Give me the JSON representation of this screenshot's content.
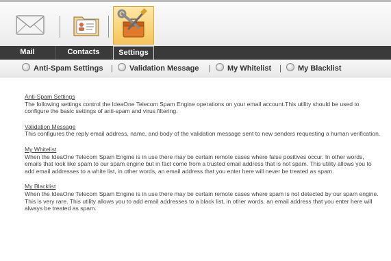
{
  "toolbar": {
    "icons": [
      {
        "name": "mail-envelope-icon"
      },
      {
        "name": "contacts-card-icon"
      },
      {
        "name": "settings-tools-icon",
        "active": true
      }
    ]
  },
  "tabs": [
    {
      "label": "Mail",
      "active": false
    },
    {
      "label": "Contacts",
      "active": false
    },
    {
      "label": "Settings",
      "active": true
    }
  ],
  "subnav": [
    {
      "label": "Anti-Spam Settings"
    },
    {
      "label": "Validation Message"
    },
    {
      "label": "My Whitelist"
    },
    {
      "label": "My Blacklist"
    }
  ],
  "sections": [
    {
      "title": "Anti-Spam Settings",
      "text": "The following settings control the IdeaOne Telecom Spam Engine operations on your email account.This utility should be used to configure the basic settings of anti-spam and virus filtering."
    },
    {
      "title": "Validation Message",
      "text": "This configures the reply email address, name, and body of the validation message sent to new senders requesting a human verification."
    },
    {
      "title": "My Whitelist",
      "text": "When the IdeaOne Telecom Spam Engine is in use there may be certain remote cases where false positives occur. In other words, emails that look like spam to our spam engine but in fact come from a trusted email address that is not spam. This utility allows you to add email addresses to a white list, in other words, an email address that you enter here will never be treated as spam."
    },
    {
      "title": "My Blacklist",
      "text": "When the IdeaOne Telecom Spam Engine is in use there may be certain remote cases where spam is not detected by our spam engine. This is very rare. This utility allows you to add email addresses to a black list, in other words, an email address that you enter here will always be treated as spam."
    }
  ],
  "colors": {
    "tabbar": "#3a3a3a",
    "active_icon_bg": "#f7c45a"
  }
}
